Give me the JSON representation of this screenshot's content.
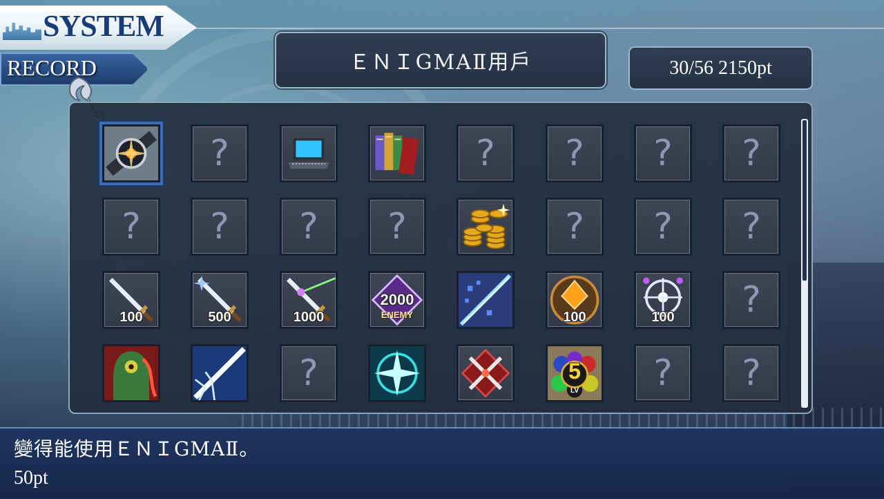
{
  "header": {
    "system_label": "SYSTEM",
    "record_label": "RECORD"
  },
  "title_panel": {
    "text": "ＥＮＩGMAⅡ用戶"
  },
  "points_panel": {
    "text": "30/56 2150pt"
  },
  "grid": {
    "rows": [
      [
        {
          "type": "icon",
          "icon": "watch-icon",
          "selected": true
        },
        {
          "type": "locked",
          "label": "?"
        },
        {
          "type": "icon",
          "icon": "laptop-icon"
        },
        {
          "type": "icon",
          "icon": "books-icon"
        },
        {
          "type": "locked",
          "label": "?"
        },
        {
          "type": "locked",
          "label": "?"
        },
        {
          "type": "locked",
          "label": "?"
        },
        {
          "type": "locked",
          "label": "?"
        }
      ],
      [
        {
          "type": "locked",
          "label": "?"
        },
        {
          "type": "locked",
          "label": "?"
        },
        {
          "type": "locked",
          "label": "?"
        },
        {
          "type": "locked",
          "label": "?"
        },
        {
          "type": "icon",
          "icon": "gold-coins-icon"
        },
        {
          "type": "locked",
          "label": "?"
        },
        {
          "type": "locked",
          "label": "?"
        },
        {
          "type": "locked",
          "label": "?"
        }
      ],
      [
        {
          "type": "icon",
          "icon": "sword-100-icon",
          "badge": "100"
        },
        {
          "type": "icon",
          "icon": "sword-500-icon",
          "badge": "500"
        },
        {
          "type": "icon",
          "icon": "sword-1000-icon",
          "badge": "1000"
        },
        {
          "type": "icon",
          "icon": "enemy-2000-icon",
          "badge": "2000",
          "badge2": "ENEMY"
        },
        {
          "type": "icon",
          "icon": "crystal-slash-icon"
        },
        {
          "type": "icon",
          "icon": "orange-gem-100-icon",
          "badge": "100"
        },
        {
          "type": "icon",
          "icon": "target-100-icon",
          "badge": "100"
        },
        {
          "type": "locked",
          "label": "?"
        }
      ],
      [
        {
          "type": "icon",
          "icon": "monster-icon"
        },
        {
          "type": "icon",
          "icon": "light-burst-icon"
        },
        {
          "type": "locked",
          "label": "?"
        },
        {
          "type": "icon",
          "icon": "blue-star-icon"
        },
        {
          "type": "icon",
          "icon": "crossed-tools-icon"
        },
        {
          "type": "icon",
          "icon": "orbs-level-5-icon",
          "badge": "5",
          "badge2": "LV"
        },
        {
          "type": "locked",
          "label": "?"
        },
        {
          "type": "locked",
          "label": "?"
        }
      ]
    ]
  },
  "description": {
    "line1": "變得能使用ＥＮＩGMAⅡ。",
    "line2": "50pt"
  },
  "colors": {
    "panel_bg": "#2f3e53",
    "panel_border": "#9fb6cc",
    "cell_bg": "#3e4656",
    "question_mark": "#8d98b5",
    "desc_bar": "#1e3460",
    "system_text": "#173c78"
  }
}
